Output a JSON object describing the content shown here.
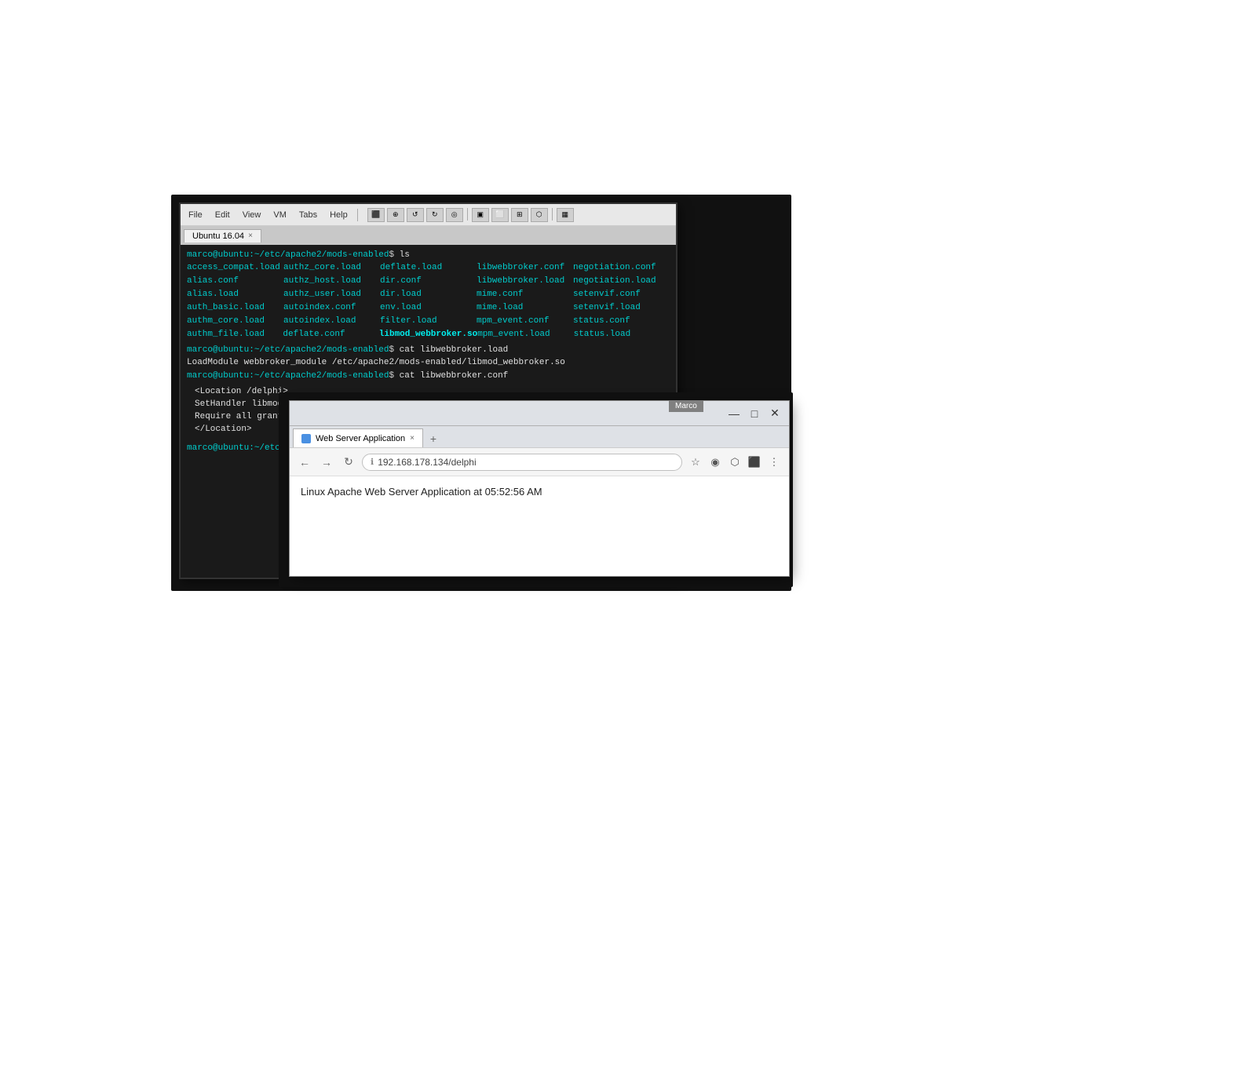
{
  "terminal": {
    "menu": {
      "file": "File",
      "edit": "Edit",
      "view": "View",
      "vm": "VM",
      "tabs": "Tabs",
      "help": "Help"
    },
    "tab": {
      "label": "Ubuntu 16.04",
      "close": "×"
    },
    "prompt": "marco@ubuntu:~/etc/apache2/mods-enabled$",
    "command1": "ls",
    "files": [
      [
        "access_compat.load",
        "authz_core.load",
        "deflate.load",
        "libwebbroker.conf"
      ],
      [
        "alias.conf",
        "authz_host.load",
        "dir.conf",
        "libwebbroker.load"
      ],
      [
        "alias.load",
        "authz_user.load",
        "dir.load",
        "mime.conf"
      ],
      [
        "auth_basic.load",
        "autoindex.conf",
        "env.load",
        "mime.load"
      ],
      [
        "authm_core.load",
        "autoindex.load",
        "filter.load",
        "mpm_event.conf"
      ],
      [
        "authm_file.load",
        "deflate.conf",
        "libmod_webbroker.so",
        "mpm_event.load"
      ]
    ],
    "files_col5": [
      "negotiation.conf",
      "negotiation.load",
      "setenvif.conf",
      "setenvif.load",
      "status.conf",
      "status.load"
    ],
    "prompt2": "marco@ubuntu:~/etc/apache2/mods-enabled$",
    "command2": "cat libwebbroker.load",
    "loadmodule_line": "LoadModule webbroker_module /etc/apache2/mods-enabled/libmod_webbroker.so",
    "prompt3": "marco@ubuntu:~/etc/apache2/mods-enabled$",
    "command3": "cat libwebbroker.conf",
    "conf_location": "<Location /delphi>",
    "conf_handler": "    SetHandler libmod_webbroker-handler",
    "conf_require": "            Require all granted",
    "conf_end": "</Location>",
    "prompt4": "marco@ubuntu:~/etc/a",
    "cursor": "_"
  },
  "browser": {
    "marco_label": "Marco",
    "tab": {
      "label": "Web Server Application",
      "close": "×"
    },
    "url": "192.168.178.134/delphi",
    "content": "Linux Apache Web Server Application at 05:52:56 AM",
    "nav": {
      "back": "←",
      "forward": "→",
      "refresh": "↻"
    },
    "window_controls": {
      "minimize": "—",
      "maximize": "□",
      "close": "✕"
    }
  }
}
